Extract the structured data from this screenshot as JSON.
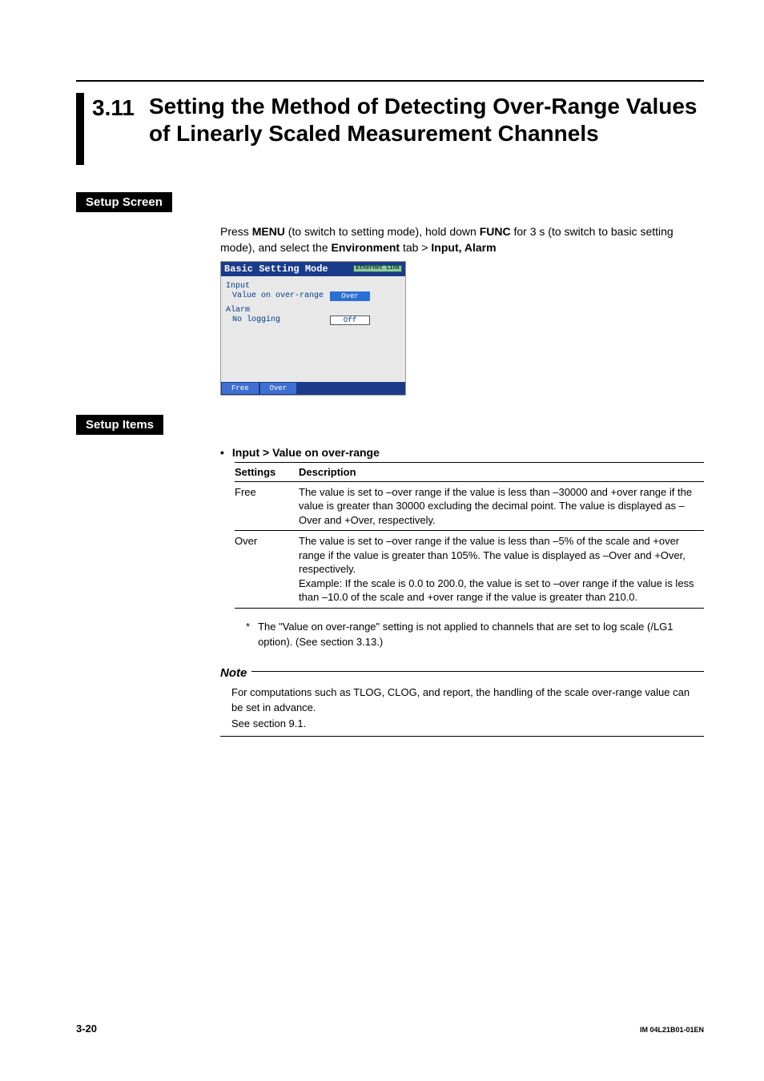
{
  "section": {
    "number": "3.11",
    "title": "Setting the Method of Detecting Over-Range Values of Linearly Scaled Measurement Channels"
  },
  "setup_screen": {
    "label": "Setup Screen",
    "instruction_parts": {
      "p1": "Press ",
      "menu": "MENU",
      "p2": " (to switch to setting mode), hold down ",
      "func": "FUNC",
      "p3": " for 3 s (to switch to basic setting mode), and select the ",
      "env": "Environment",
      "p4": " tab > ",
      "ia": "Input, Alarm"
    },
    "screenshot": {
      "title": "Basic Setting Mode",
      "eth_badge": "Ethernet Link",
      "group1_label": "Input",
      "row1_label": "Value on over-range",
      "row1_value": "Over",
      "group2_label": "Alarm",
      "row2_label": "No logging",
      "row2_value": "Off",
      "btn1": "Free",
      "btn2": "Over"
    }
  },
  "setup_items": {
    "label": "Setup Items",
    "subhead": "Input > Value on over-range",
    "table": {
      "head_settings": "Settings",
      "head_desc": "Description",
      "row1_setting": "Free",
      "row1_desc": "The value is set to –over range if the value is less than –30000 and +over range if the value is greater than 30000 excluding the decimal point. The value is displayed as –Over and +Over, respectively.",
      "row2_setting": "Over",
      "row2_desc_a": "The value is set to –over range if the value is less than –5% of the scale and +over range if the value is greater than 105%. The value is displayed as –Over and +Over, respectively.",
      "row2_desc_b": "Example:  If the scale is 0.0 to 200.0, the value is set to –over range if the value is less than –10.0 of the scale and +over range if the value is greater than 210.0."
    },
    "footnote_mark": "*",
    "footnote": "The \"Value on over-range\" setting is not applied to channels that are set to log scale (/LG1 option). (See section 3.13.)",
    "note_title": "Note",
    "note_body_a": "For computations such as TLOG, CLOG, and report, the handling of the scale over-range value can be set in advance.",
    "note_body_b": "See section 9.1."
  },
  "footer": {
    "page": "3-20",
    "docid": "IM 04L21B01-01EN"
  }
}
